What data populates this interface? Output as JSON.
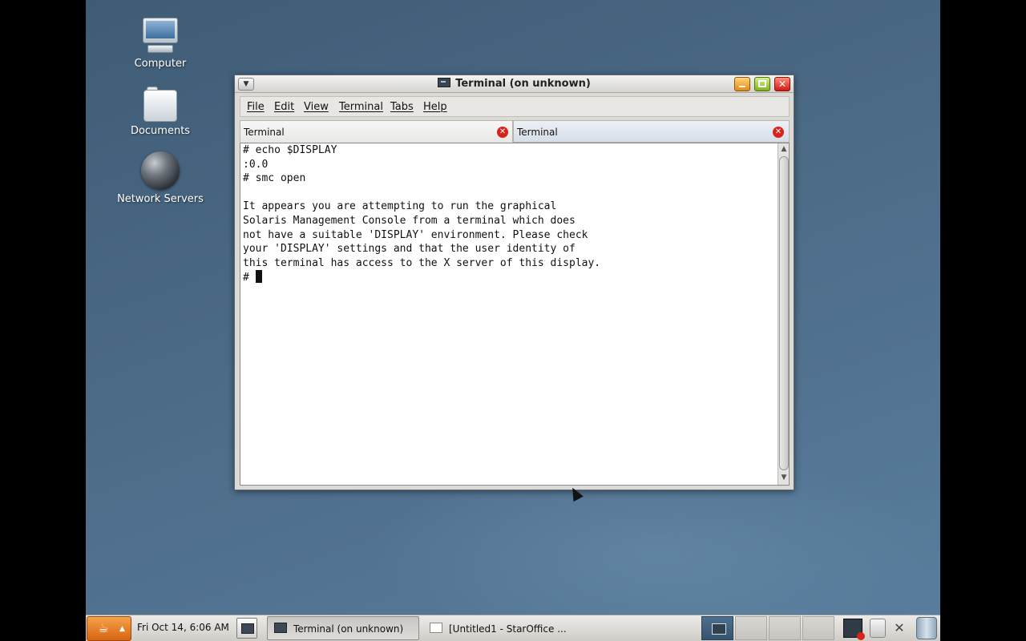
{
  "desktop": {
    "icons": [
      {
        "label": "Computer",
        "icon": "computer-icon"
      },
      {
        "label": "Documents",
        "icon": "folder-icon"
      },
      {
        "label": "Network Servers",
        "icon": "globe-icon"
      }
    ]
  },
  "window": {
    "title": "Terminal (on unknown)",
    "menu": [
      "File",
      "Edit",
      "View",
      "Terminal",
      "Tabs",
      "Help"
    ],
    "tabs": [
      {
        "label": "Terminal",
        "active": true
      },
      {
        "label": "Terminal",
        "active": false
      }
    ],
    "terminal_lines": [
      "# echo $DISPLAY",
      ":0.0",
      "# smc open",
      "",
      "It appears you are attempting to run the graphical",
      "Solaris Management Console from a terminal which does",
      "not have a suitable 'DISPLAY' environment. Please check",
      "your 'DISPLAY' settings and that the user identity of",
      "this terminal has access to the X server of this display."
    ],
    "prompt": "# "
  },
  "taskbar": {
    "clock": "Fri Oct 14,  6:06 AM",
    "tasks": [
      {
        "label": "Terminal (on unknown)",
        "icon": "terminal-icon",
        "active": true
      },
      {
        "label": "[Untitled1 - StarOffice ...",
        "icon": "document-icon",
        "active": false
      }
    ],
    "workspaces": 4,
    "colors": {
      "accent": "#d7650f",
      "desktop": "#4c6b87"
    }
  }
}
